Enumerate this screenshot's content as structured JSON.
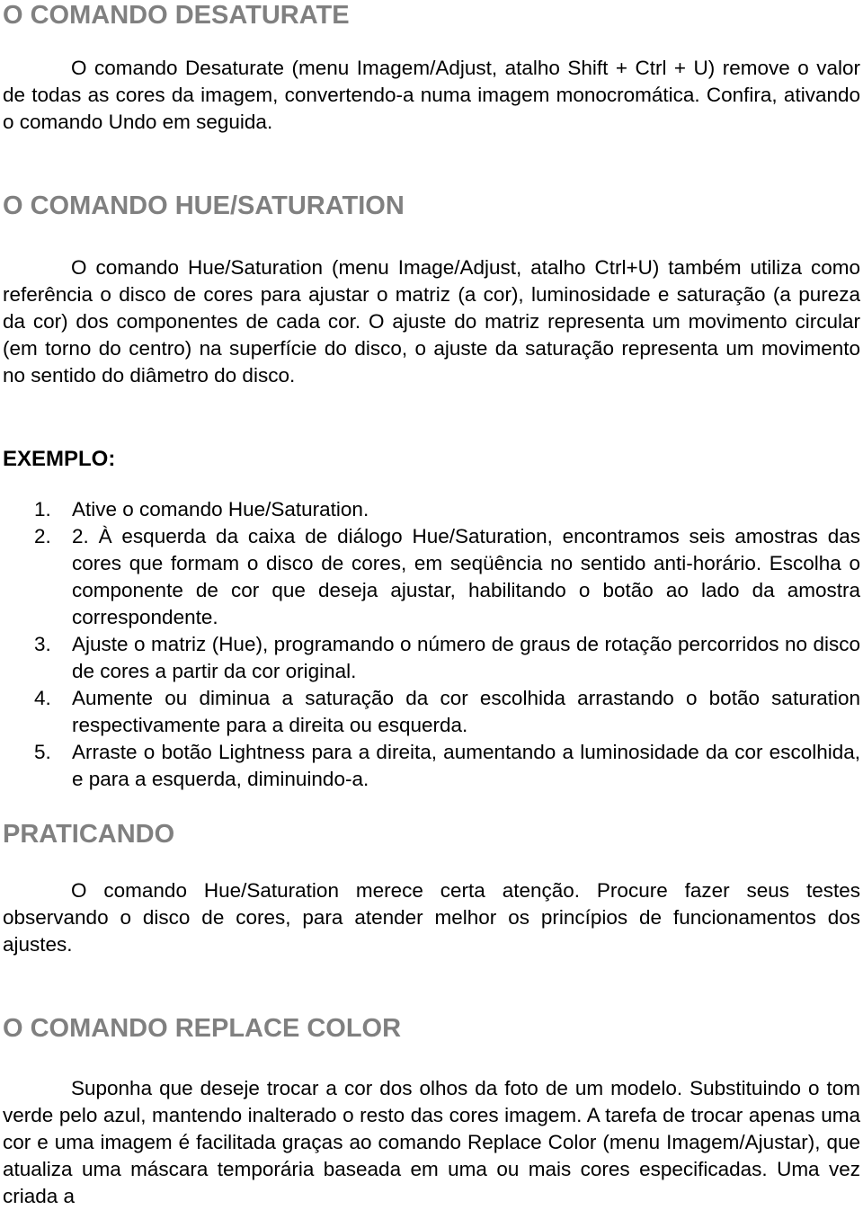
{
  "sections": {
    "desaturate": {
      "title": "O COMANDO DESATURATE",
      "paragraph": "O comando Desaturate (menu Imagem/Adjust, atalho Shift + Ctrl + U) remove o valor de todas as cores da imagem, convertendo-a numa imagem monocromática. Confira, ativando o comando Undo em seguida."
    },
    "hue_saturation": {
      "title": "O COMANDO HUE/SATURATION",
      "paragraph": "O comando Hue/Saturation (menu Image/Adjust, atalho Ctrl+U) também utiliza como referência o disco de cores para ajustar o matriz (a cor), luminosidade e saturação (a pureza da cor) dos componentes de cada cor. O ajuste do matriz representa um movimento circular (em torno do centro) na superfície do disco, o ajuste da saturação representa um movimento no sentido do diâmetro do disco."
    },
    "example": {
      "title": "EXEMPLO:",
      "steps": [
        {
          "number": "1.",
          "text": "Ative o comando Hue/Saturation."
        },
        {
          "number": "2.",
          "text": "2. À esquerda da caixa de diálogo Hue/Saturation, encontramos seis amostras das cores que formam o disco de cores, em seqüência no sentido anti-horário. Escolha o componente de cor que deseja ajustar, habilitando o botão ao lado da amostra correspondente."
        },
        {
          "number": "3.",
          "text": "Ajuste o matriz (Hue), programando o número de graus de rotação percorridos no disco de cores a partir da cor original."
        },
        {
          "number": "4.",
          "text": "Aumente ou diminua a saturação da cor escolhida arrastando o botão saturation respectivamente para a direita ou esquerda."
        },
        {
          "number": "5.",
          "text": "Arraste o botão Lightness para a direita, aumentando a luminosidade da cor escolhida, e para a esquerda, diminuindo-a."
        }
      ]
    },
    "practicing": {
      "title": "PRATICANDO",
      "paragraph": "O comando Hue/Saturation merece certa atenção. Procure fazer seus testes observando o disco de cores, para atender melhor os princípios de funcionamentos dos ajustes."
    },
    "replace_color": {
      "title": "O COMANDO REPLACE COLOR",
      "paragraph": "Suponha que deseje trocar a cor dos olhos da foto de um modelo. Substituindo o tom verde pelo azul, mantendo inalterado o resto das cores imagem. A tarefa de trocar apenas uma cor e uma imagem é facilitada graças ao comando Replace Color (menu Imagem/Ajustar), que atualiza uma máscara temporária baseada em uma ou mais cores especificadas. Uma vez criada a"
    }
  },
  "colors": {
    "heading_gray": "#808080",
    "text": "#000000",
    "background": "#ffffff"
  }
}
